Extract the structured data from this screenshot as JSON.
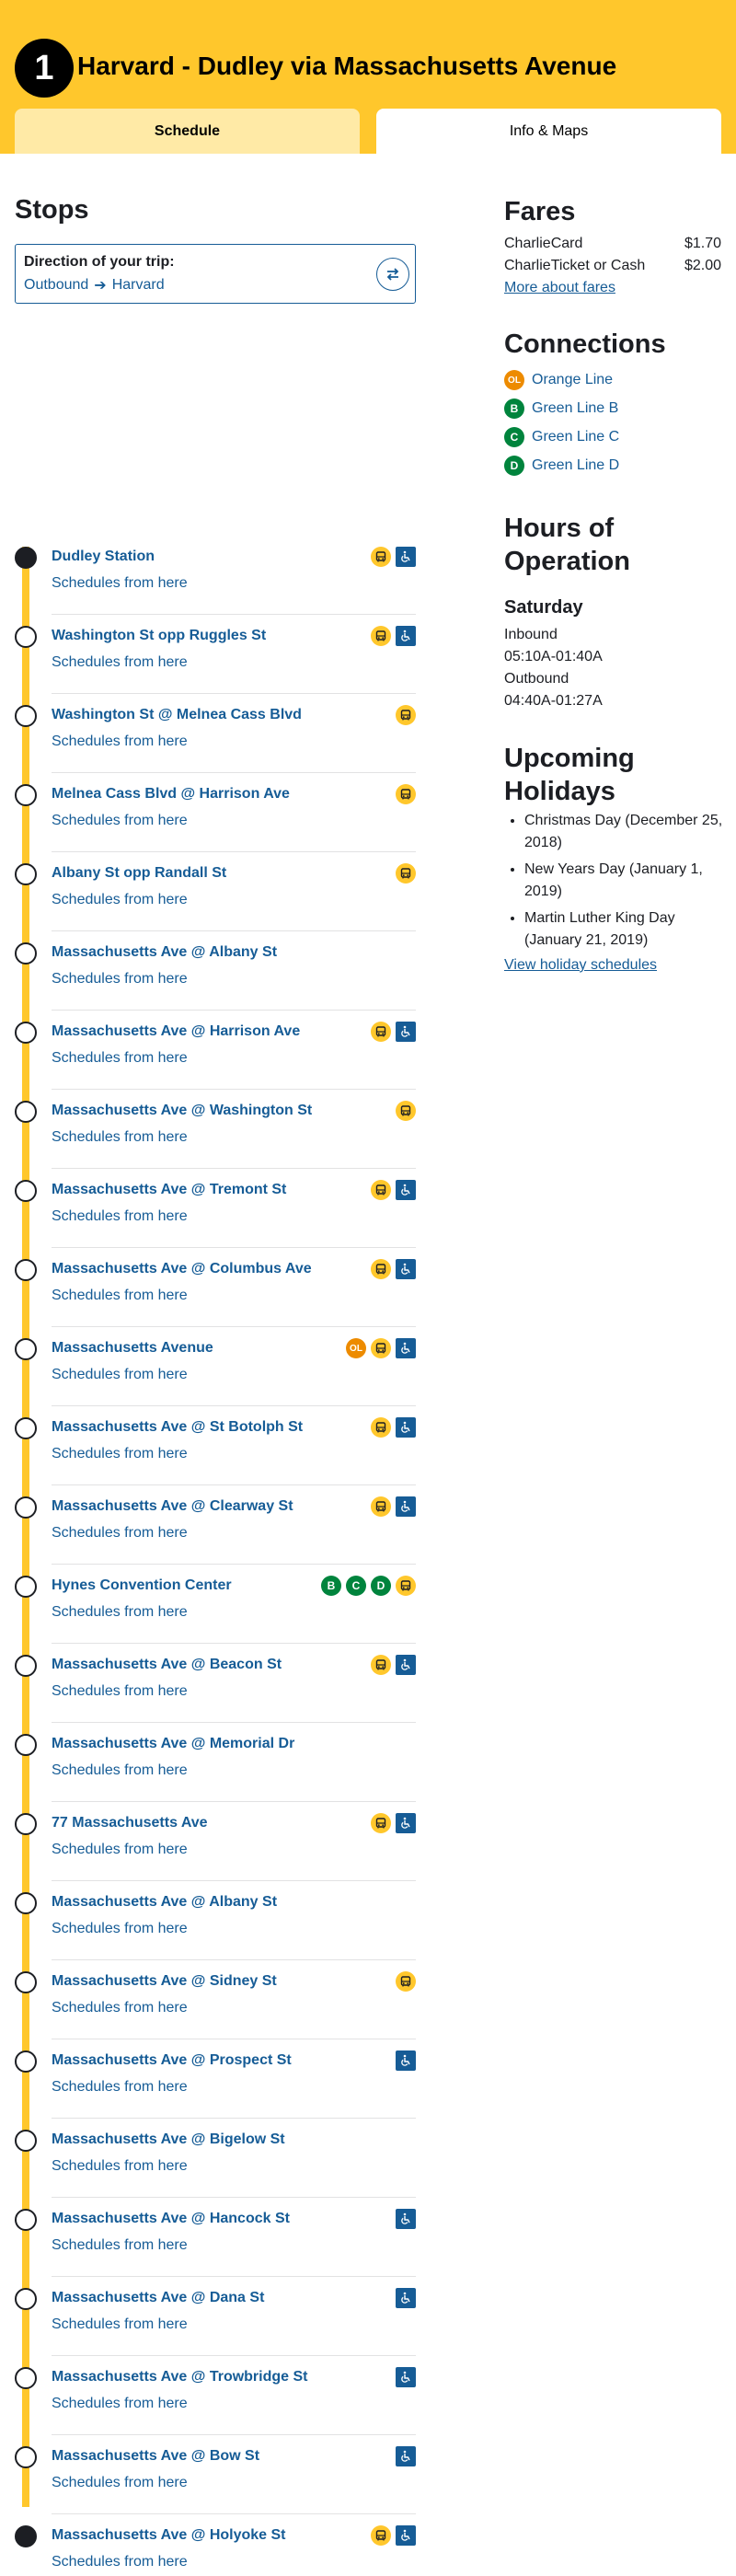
{
  "header": {
    "route_number": "1",
    "route_title": "Harvard - Dudley via Massachusetts Avenue",
    "tabs": [
      {
        "label": "Schedule"
      },
      {
        "label": "Info & Maps"
      }
    ]
  },
  "stops_section": {
    "title": "Stops",
    "direction_label": "Direction of your trip:",
    "direction_from": "Outbound",
    "direction_to": "Harvard",
    "stops": [
      {
        "name": "Dudley Station",
        "link": "Schedules from here",
        "icons": [
          "bus-icon",
          "accessible-icon"
        ],
        "terminus": true
      },
      {
        "name": "Washington St opp Ruggles St",
        "link": "Schedules from here",
        "icons": [
          "bus-icon",
          "accessible-icon"
        ]
      },
      {
        "name": "Washington St @ Melnea Cass Blvd",
        "link": "Schedules from here",
        "icons": [
          "bus-icon"
        ]
      },
      {
        "name": "Melnea Cass Blvd @ Harrison Ave",
        "link": "Schedules from here",
        "icons": [
          "bus-icon"
        ]
      },
      {
        "name": "Albany St opp Randall St",
        "link": "Schedules from here",
        "icons": [
          "bus-icon"
        ]
      },
      {
        "name": "Massachusetts Ave @ Albany St",
        "link": "Schedules from here",
        "icons": []
      },
      {
        "name": "Massachusetts Ave @ Harrison Ave",
        "link": "Schedules from here",
        "icons": [
          "bus-icon",
          "accessible-icon"
        ]
      },
      {
        "name": "Massachusetts Ave @ Washington St",
        "link": "Schedules from here",
        "icons": [
          "bus-icon"
        ]
      },
      {
        "name": "Massachusetts Ave @ Tremont St",
        "link": "Schedules from here",
        "icons": [
          "bus-icon",
          "accessible-icon"
        ]
      },
      {
        "name": "Massachusetts Ave @ Columbus Ave",
        "link": "Schedules from here",
        "icons": [
          "bus-icon",
          "accessible-icon"
        ]
      },
      {
        "name": "Massachusetts Avenue",
        "link": "Schedules from here",
        "icons": [
          "orange-line-icon",
          "bus-icon",
          "accessible-icon"
        ]
      },
      {
        "name": "Massachusetts Ave @ St Botolph St",
        "link": "Schedules from here",
        "icons": [
          "bus-icon",
          "accessible-icon"
        ]
      },
      {
        "name": "Massachusetts Ave @ Clearway St",
        "link": "Schedules from here",
        "icons": [
          "bus-icon",
          "accessible-icon"
        ]
      },
      {
        "name": "Hynes Convention Center",
        "link": "Schedules from here",
        "icons": [
          "green-b-icon",
          "green-c-icon",
          "green-d-icon",
          "bus-icon"
        ]
      },
      {
        "name": "Massachusetts Ave @ Beacon St",
        "link": "Schedules from here",
        "icons": [
          "bus-icon",
          "accessible-icon"
        ]
      },
      {
        "name": "Massachusetts Ave @ Memorial Dr",
        "link": "Schedules from here",
        "icons": []
      },
      {
        "name": "77 Massachusetts Ave",
        "link": "Schedules from here",
        "icons": [
          "bus-icon",
          "accessible-icon"
        ]
      },
      {
        "name": "Massachusetts Ave @ Albany St",
        "link": "Schedules from here",
        "icons": []
      },
      {
        "name": "Massachusetts Ave @ Sidney St",
        "link": "Schedules from here",
        "icons": [
          "bus-icon"
        ]
      },
      {
        "name": "Massachusetts Ave @ Prospect St",
        "link": "Schedules from here",
        "icons": [
          "accessible-icon"
        ]
      },
      {
        "name": "Massachusetts Ave @ Bigelow St",
        "link": "Schedules from here",
        "icons": []
      },
      {
        "name": "Massachusetts Ave @ Hancock St",
        "link": "Schedules from here",
        "icons": [
          "accessible-icon"
        ]
      },
      {
        "name": "Massachusetts Ave @ Dana St",
        "link": "Schedules from here",
        "icons": [
          "accessible-icon"
        ]
      },
      {
        "name": "Massachusetts Ave @ Trowbridge St",
        "link": "Schedules from here",
        "icons": [
          "accessible-icon"
        ]
      },
      {
        "name": "Massachusetts Ave @ Bow St",
        "link": "Schedules from here",
        "icons": [
          "accessible-icon"
        ]
      },
      {
        "name": "Massachusetts Ave @ Holyoke St",
        "link": "Schedules from here",
        "icons": [
          "bus-icon",
          "accessible-icon"
        ],
        "terminus": true
      }
    ]
  },
  "fares": {
    "title": "Fares",
    "rows": [
      {
        "label": "CharlieCard",
        "price": "$1.70"
      },
      {
        "label": "CharlieTicket or Cash",
        "price": "$2.00"
      }
    ],
    "more_link": "More about fares"
  },
  "connections": {
    "title": "Connections",
    "items": [
      {
        "badge": "OL",
        "label": "Orange Line",
        "color": "#ed8b00"
      },
      {
        "badge": "B",
        "label": "Green Line B",
        "color": "#00843d"
      },
      {
        "badge": "C",
        "label": "Green Line C",
        "color": "#00843d"
      },
      {
        "badge": "D",
        "label": "Green Line D",
        "color": "#00843d"
      }
    ]
  },
  "hours": {
    "title_line1": "Hours of",
    "title_line2": "Operation",
    "day": "Saturday",
    "inbound_label": "Inbound",
    "inbound_time": "05:10A-01:40A",
    "outbound_label": "Outbound",
    "outbound_time": "04:40A-01:27A"
  },
  "holidays": {
    "title_line1": "Upcoming",
    "title_line2": "Holidays",
    "items": [
      "Christmas Day (December 25, 2018)",
      "New Years Day (January 1, 2019)",
      "Martin Luther King Day (January 21, 2019)"
    ],
    "link": "View holiday schedules"
  },
  "colors": {
    "accent_yellow": "#ffc72c",
    "link_blue": "#165c96",
    "orange_line": "#ed8b00",
    "green_line": "#00843d"
  }
}
